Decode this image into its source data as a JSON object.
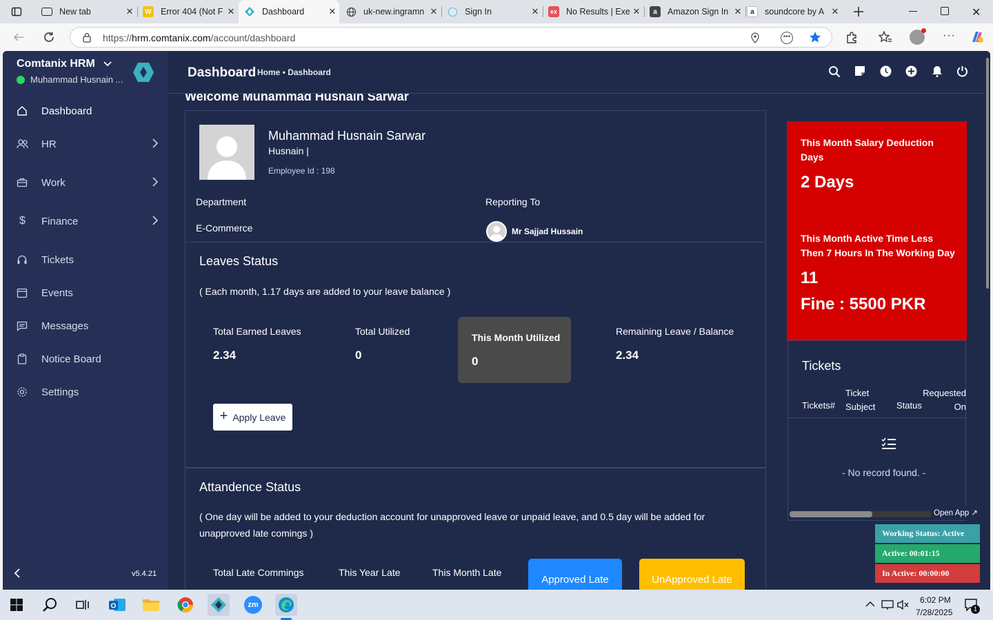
{
  "browser": {
    "tabs": [
      {
        "title": "New tab",
        "icon": "new-tab-icon"
      },
      {
        "title": "Error 404 (Not F",
        "icon": "w-site-icon"
      },
      {
        "title": "Dashboard",
        "icon": "comtanix-icon"
      },
      {
        "title": "uk-new.ingramn",
        "icon": "globe-icon"
      },
      {
        "title": "Sign In",
        "icon": "sign-in-icon"
      },
      {
        "title": "No Results | Exe",
        "icon": "ex-site-icon"
      },
      {
        "title": "Amazon Sign In",
        "icon": "amazon-icon"
      },
      {
        "title": "soundcore by A",
        "icon": "amazon-icon"
      }
    ],
    "url_prefix": "https://",
    "url_host": "hrm.comtanix.com",
    "url_path": "/account/dashboard"
  },
  "sidebar": {
    "brand": "Comtanix HRM",
    "user": "Muhammad Husnain ...",
    "items": [
      {
        "label": "Dashboard",
        "icon": "home-icon"
      },
      {
        "label": "HR",
        "icon": "users-icon"
      },
      {
        "label": "Work",
        "icon": "briefcase-icon"
      },
      {
        "label": "Finance",
        "icon": "dollar-icon"
      },
      {
        "label": "Tickets",
        "icon": "headset-icon"
      },
      {
        "label": "Events",
        "icon": "calendar-icon"
      },
      {
        "label": "Messages",
        "icon": "message-icon"
      },
      {
        "label": "Notice Board",
        "icon": "clipboard-icon"
      },
      {
        "label": "Settings",
        "icon": "gear-icon"
      }
    ],
    "version": "v5.4.21"
  },
  "topbar": {
    "title": "Dashboard",
    "breadcrumb": "Home • Dashboard"
  },
  "welcome": "Welcome Muhammad Husnain Sarwar",
  "profile": {
    "name": "Muhammad Husnain Sarwar",
    "short": "Husnain |",
    "employee_id": "Employee Id : 198",
    "department_label": "Department",
    "department": "E-Commerce",
    "reporting_label": "Reporting To",
    "reporting_to": "Mr Sajjad Hussain"
  },
  "leaves": {
    "title": "Leaves Status",
    "note": "( Each month, 1.17 days are added to your leave balance )",
    "stats": [
      {
        "label": "Total Earned Leaves",
        "value": "2.34"
      },
      {
        "label": "Total Utilized",
        "value": "0"
      },
      {
        "label": "This Month Utilized",
        "value": "0"
      },
      {
        "label": "Remaining Leave / Balance",
        "value": "2.34"
      }
    ],
    "apply_button": "Apply Leave"
  },
  "attendance": {
    "title": "Attandence Status",
    "note_line1": "( One day will be added to your deduction account for unapproved leave or unpaid leave, and 0.5 day will be added for",
    "note_line2": "unapproved late comings )",
    "stats": [
      "Total Late Commings",
      "This Year Late",
      "This Month Late"
    ],
    "approved_button": "Approved Late",
    "unapproved_button": "UnApproved Late"
  },
  "red_card": {
    "deduction_label_1": "This Month Salary Deduction",
    "deduction_label_2": "Days",
    "deduction_value": "2 Days",
    "active_label_1": "This Month Active Time Less",
    "active_label_2": "Then 7 Hours In The Working Day",
    "active_value": "11",
    "fine": "Fine : 5500 PKR"
  },
  "tickets": {
    "title": "Tickets",
    "columns": [
      "Tickets#",
      "Ticket Subject",
      "Status",
      "Requested On"
    ],
    "empty": "- No record found. -",
    "open_app": "Open App ↗"
  },
  "work_status": {
    "status": "Working Status: Active",
    "active": "Active: 00:01:15",
    "inactive": "In Active: 00:00:00"
  },
  "taskbar": {
    "time": "6:02 PM",
    "date": "7/28/2025",
    "notifications": "1"
  },
  "colors": {
    "page_bg": "#1f2a4b",
    "sidebar_bg": "#263057",
    "red_card": "#d50000",
    "approved": "#1e88ff",
    "unapproved": "#ffbf00",
    "status_active": "#26a96c",
    "status_inactive": "#d23c3c",
    "status_working": "#3aa1a8"
  }
}
